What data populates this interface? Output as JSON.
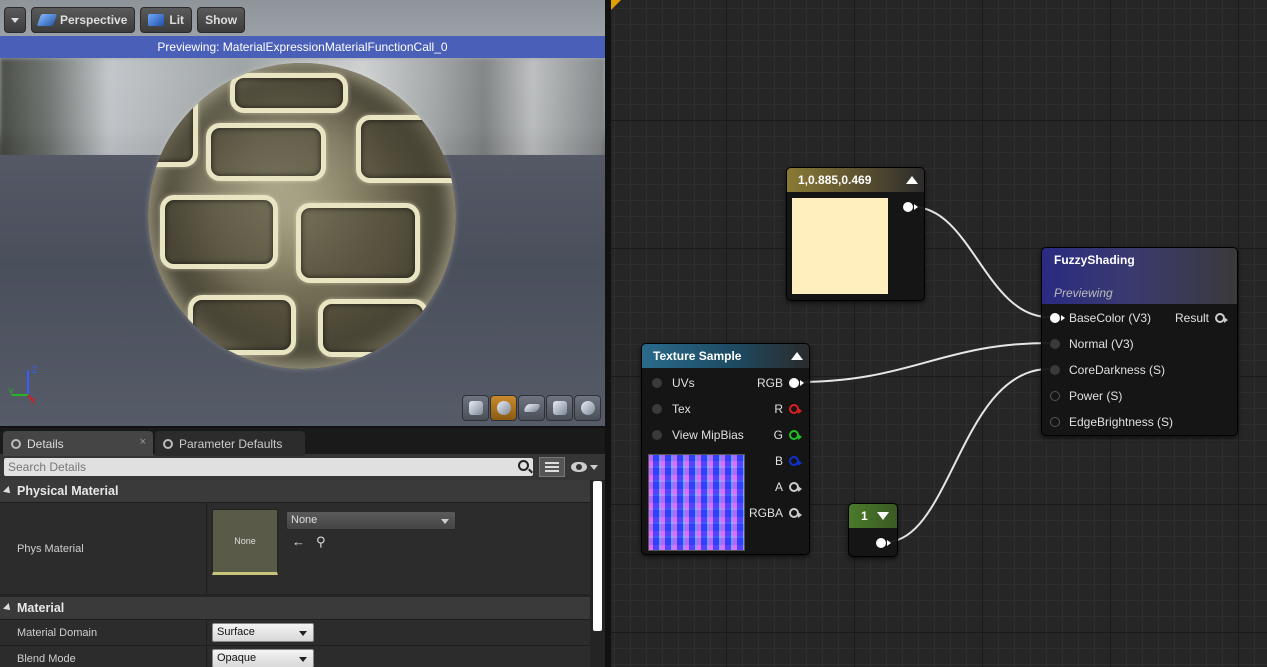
{
  "viewport": {
    "toolbar": {
      "perspective_label": "Perspective",
      "lit_label": "Lit",
      "show_label": "Show"
    },
    "banner": "Previewing: MaterialExpressionMaterialFunctionCall_0",
    "axis": {
      "z": "Z",
      "y": "Y",
      "x": "X"
    }
  },
  "details": {
    "tabs": [
      {
        "label": "Details",
        "close": "×"
      },
      {
        "label": "Parameter Defaults",
        "close": ""
      }
    ],
    "search_placeholder": "Search Details",
    "sections": [
      {
        "title": "Physical Material",
        "rows": [
          {
            "name": "Phys Material",
            "thumb_label": "None",
            "value": "None"
          }
        ]
      },
      {
        "title": "Material",
        "rows": [
          {
            "name": "Material Domain",
            "value": "Surface"
          },
          {
            "name": "Blend Mode",
            "value": "Opaque"
          }
        ]
      }
    ]
  },
  "graph": {
    "constant3": {
      "title": "1,0.885,0.469",
      "color": "#ffefbf"
    },
    "texture_sample": {
      "title": "Texture Sample",
      "inputs": [
        "UVs",
        "Tex",
        "View MipBias"
      ],
      "outputs": [
        "RGB",
        "R",
        "G",
        "B",
        "A",
        "RGBA"
      ]
    },
    "constant": {
      "title": "1"
    },
    "fuzzy_shading": {
      "title": "FuzzyShading",
      "subtitle": "Previewing",
      "inputs": [
        "BaseColor (V3)",
        "Normal (V3)",
        "CoreDarkness (S)",
        "Power (S)",
        "EdgeBrightness (S)"
      ],
      "output": "Result"
    }
  },
  "colors": {
    "banner": "#4a5fb8",
    "constant3_header": "#8a7a35",
    "texture_header": "#2a6a8a",
    "constant_header": "#4a7a2a",
    "fuzzy_header": "#2c2c78"
  }
}
